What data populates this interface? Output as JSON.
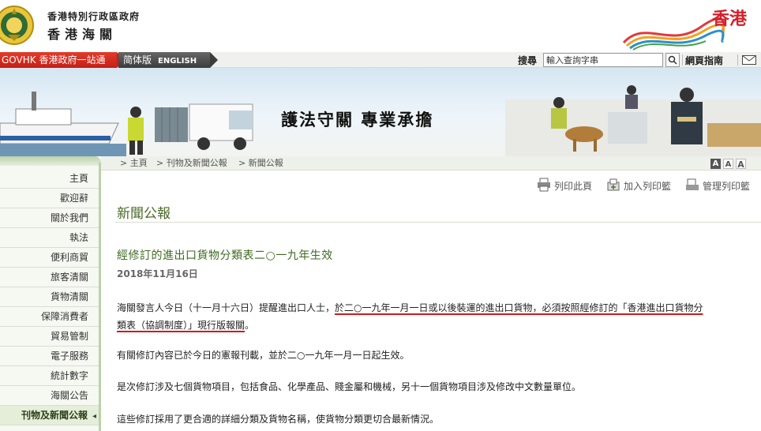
{
  "header": {
    "dept_name_zh_small": "香港特別行政區政府",
    "dept_name_zh_large": "香港海關",
    "brand_text": "香港"
  },
  "nav": {
    "gov_portal": "GOVHK 香港政府一站通",
    "simplified": "简体版",
    "english": "ENGLISH",
    "search_label": "搜尋",
    "search_placeholder": "輸入查詢字串",
    "search_button_icon": "magnifier-icon",
    "sitemap": "網頁指南",
    "mail_icon": "envelope-icon"
  },
  "banner": {
    "slogan": "護法守關 專業承擔"
  },
  "breadcrumb": {
    "items": [
      "> 主頁",
      "> 刊物及新聞公報",
      "> 新聞公報"
    ],
    "font_sizes": [
      "A",
      "A",
      "A"
    ]
  },
  "sidebar": {
    "items": [
      "主頁",
      "歡迎辭",
      "關於我們",
      "執法",
      "便利商貿",
      "旅客清關",
      "貨物清關",
      "保障消費者",
      "貿易管制",
      "電子服務",
      "統計數字",
      "海關公告",
      "刊物及新聞公報"
    ],
    "active_index": 12
  },
  "tools": {
    "print": "列印此頁",
    "add_print": "加入列印籃",
    "manage_print": "管理列印籃"
  },
  "content": {
    "section_title": "新聞公報",
    "news_title": "經修訂的進出口貨物分類表二○一九年生效",
    "news_date": "2018年11月16日",
    "para1_plain": "海關發言人今日（十一月十六日）提醒進出口人士，",
    "para1_emph_line1": "於二○一九年一月一日或以後裝運的進出口貨物，必須按照經修訂的「香港進出口貨物分",
    "para1_emph_line2": "類表（協調制度）」現行版報關",
    "para1_tail": "。",
    "para2": "有關修訂內容已於今日的憲報刊載，並於二○一九年一月一日起生效。",
    "para3": "是次修訂涉及七個貨物項目，包括食品、化學產品、賤金屬和機械，另十一個貨物項目涉及修改中文數量單位。",
    "para4": "這些修訂採用了更合適的詳細分類及貨物名稱，使貨物分類更切合最新情況。"
  },
  "colors": {
    "gov_red": "#d42a1e",
    "section_green": "#4a6a27",
    "underline_red": "#d11a1a"
  }
}
